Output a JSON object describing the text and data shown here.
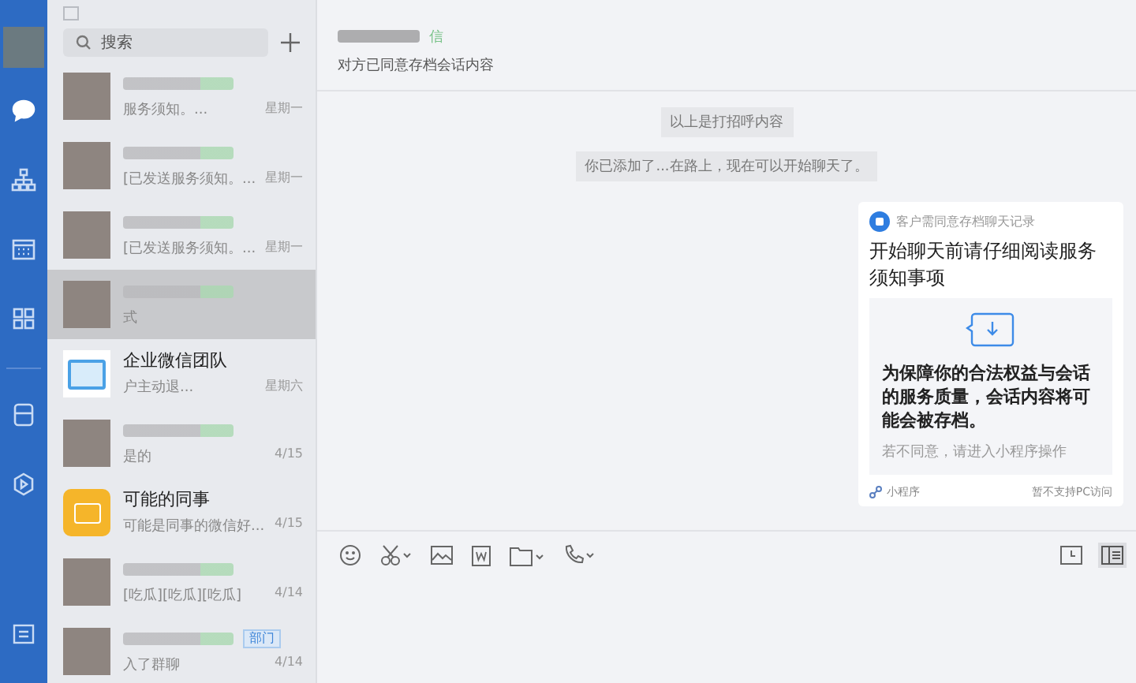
{
  "rail": {
    "items": [
      {
        "kind": "chat",
        "selected": true
      },
      {
        "kind": "org",
        "selected": false
      },
      {
        "kind": "calendar",
        "selected": false
      },
      {
        "kind": "apps",
        "selected": false
      },
      {
        "kind": "doc",
        "selected": false
      },
      {
        "kind": "hexagon",
        "selected": false
      }
    ]
  },
  "chat_list": {
    "search": {
      "placeholder": "搜索"
    },
    "items": [
      {
        "kind": "photo",
        "preview": "服务须知。...",
        "time": "星期一",
        "selected": false
      },
      {
        "kind": "photo",
        "preview": "[已发送服务须知。...",
        "time": "星期一",
        "selected": false
      },
      {
        "kind": "photo",
        "preview": "[已发送服务须知。...",
        "time": "星期一",
        "selected": false
      },
      {
        "kind": "photo",
        "preview": "式",
        "selected": true
      },
      {
        "kind": "team",
        "name": "企业微信团队",
        "preview": "户主动退...",
        "time": "星期六",
        "selected": false
      },
      {
        "kind": "photo",
        "preview": "是的",
        "time": "4/15",
        "selected": false
      },
      {
        "kind": "colleague",
        "name": "可能的同事",
        "preview": "可能是同事的微信好...",
        "time": "4/15",
        "selected": false
      },
      {
        "kind": "photo",
        "preview": "[吃瓜][吃瓜][吃瓜]",
        "time": "4/14",
        "selected": false
      },
      {
        "kind": "photo",
        "badge": "部门",
        "preview": "入了群聊",
        "time": "4/14",
        "selected": false
      }
    ]
  },
  "chat": {
    "source": "信",
    "subtitle": "对方已同意存档会话内容",
    "notices": [
      "以上是打招呼内容",
      "你已添加了...在路上，现在可以开始聊天了。"
    ],
    "card": {
      "source": "客户需同意存档聊天记录",
      "title": "开始聊天前请仔细阅读服务须知事项",
      "body": "为保障你的合法权益与会话的服务质量，会话内容将可能会被存档。",
      "note": "若不同意，请进入小程序操作",
      "footer_left": "小程序",
      "footer_right": "暂不支持PC访问"
    }
  }
}
